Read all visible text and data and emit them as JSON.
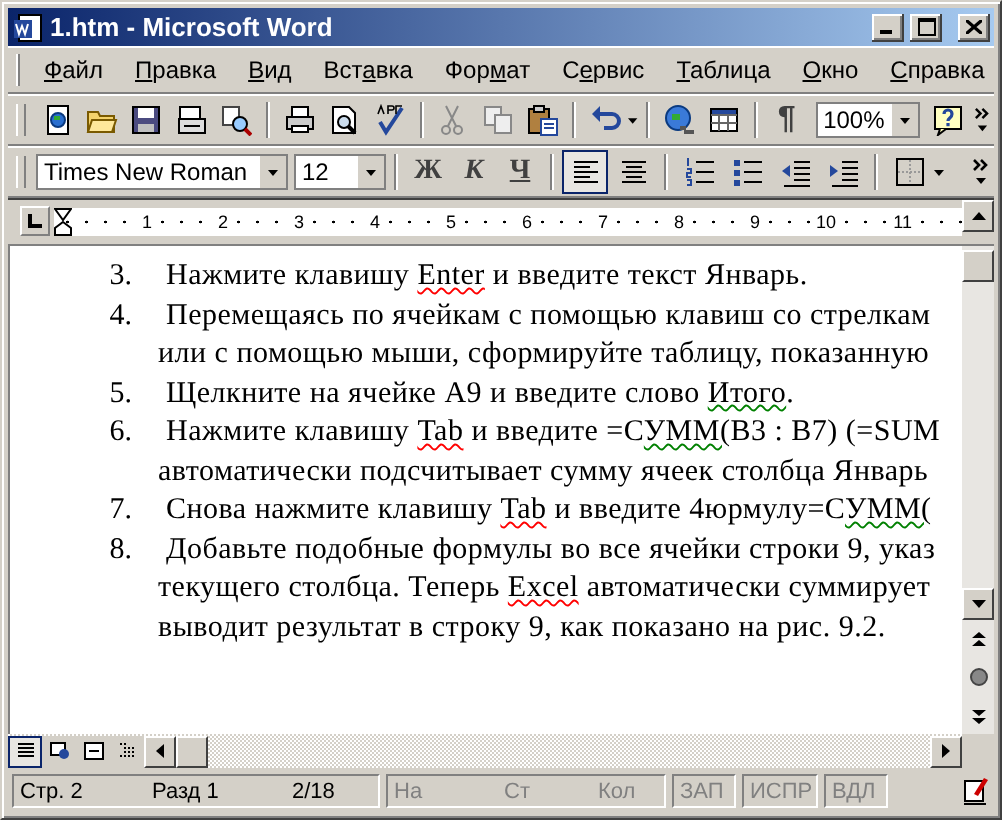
{
  "window": {
    "title": "1.htm - Microsoft Word"
  },
  "menu": [
    {
      "label": "Файл"
    },
    {
      "label": "Правка"
    },
    {
      "label": "Вид"
    },
    {
      "label": "Вставка"
    },
    {
      "label": "Формат"
    },
    {
      "label": "Сервис"
    },
    {
      "label": "Таблица"
    },
    {
      "label": "Окно"
    },
    {
      "label": "Справка"
    }
  ],
  "toolbar": {
    "pilcrow": "¶",
    "zoom": "100%"
  },
  "formatting": {
    "font": "Times New Roman",
    "size": "12",
    "styles": [
      {
        "kind": "bold",
        "label": "Ж"
      },
      {
        "kind": "italic",
        "label": "К"
      },
      {
        "kind": "underline",
        "label": "Ч"
      }
    ],
    "align": [
      {
        "kind": "left",
        "selected": true
      },
      {
        "kind": "center",
        "selected": false
      }
    ]
  },
  "ruler": {
    "marks": [
      "1",
      "2",
      "3",
      "4",
      "5",
      "6",
      "7",
      "8",
      "9",
      "10",
      "11"
    ]
  },
  "document": {
    "items": [
      {
        "number": "3.",
        "lines": [
          [
            {
              "text": "Нажмите клавишу "
            },
            {
              "text": "Enter",
              "spelling_error": true
            },
            {
              "text": " и введите текст Январь."
            }
          ]
        ]
      },
      {
        "number": "4.",
        "lines": [
          [
            {
              "text": "Перемещаясь по ячейкам с помощью клавиш со стрелкам"
            }
          ],
          [
            {
              "text": "или с помощью мыши, сформируйте таблицу, показанную"
            }
          ]
        ]
      },
      {
        "number": "5.",
        "lines": [
          [
            {
              "text": "Щелкните на ячейке А9 и введите слово "
            },
            {
              "text": "Итого",
              "grammar_error": true
            },
            {
              "text": "."
            }
          ]
        ]
      },
      {
        "number": "6.",
        "lines": [
          [
            {
              "text": "Нажмите клавишу "
            },
            {
              "text": "Tab",
              "spelling_error": true
            },
            {
              "text": " и введите =С"
            },
            {
              "text": "УММ(",
              "grammar_error": true
            },
            {
              "text": "B3 : B7) (=SUM"
            }
          ],
          [
            {
              "text": "автоматически подсчитывает сумму ячеек столбца Январь"
            }
          ]
        ]
      },
      {
        "number": "7.",
        "lines": [
          [
            {
              "text": "Снова нажмите клавишу "
            },
            {
              "text": "Tab",
              "spelling_error": true
            },
            {
              "text": " и введите 4юрмулу=С"
            },
            {
              "text": "УММ(",
              "grammar_error": true
            }
          ]
        ]
      },
      {
        "number": "8.",
        "lines": [
          [
            {
              "text": "Добавьте подобные формулы во все ячейки строки 9, указ"
            }
          ],
          [
            {
              "text": "текущего столбца. Теперь "
            },
            {
              "text": "Excel",
              "spelling_error": true
            },
            {
              "text": " автоматически суммирует"
            }
          ],
          [
            {
              "text": "выводит результат в строку 9, как показано на рис. 9.2."
            }
          ]
        ]
      }
    ]
  },
  "view_buttons": [
    {
      "kind": "normal",
      "selected": true
    },
    {
      "kind": "web",
      "selected": false
    },
    {
      "kind": "print",
      "selected": false
    },
    {
      "kind": "outline",
      "selected": false
    }
  ],
  "status_bar": {
    "panels": [
      {
        "fields": [
          {
            "text": "Стр. 2",
            "disabled": false
          },
          {
            "text": "Разд 1",
            "disabled": false
          },
          {
            "text": "2/18",
            "disabled": false
          }
        ]
      },
      {
        "fields": [
          {
            "text": "На",
            "disabled": true
          },
          {
            "text": "Ст",
            "disabled": true
          },
          {
            "text": "Кол",
            "disabled": true
          }
        ]
      },
      {
        "fields": [
          {
            "text": "ЗАП",
            "disabled": true
          }
        ]
      },
      {
        "fields": [
          {
            "text": "ИСПР",
            "disabled": true
          }
        ]
      },
      {
        "fields": [
          {
            "text": "ВДЛ",
            "disabled": true
          }
        ]
      }
    ]
  }
}
